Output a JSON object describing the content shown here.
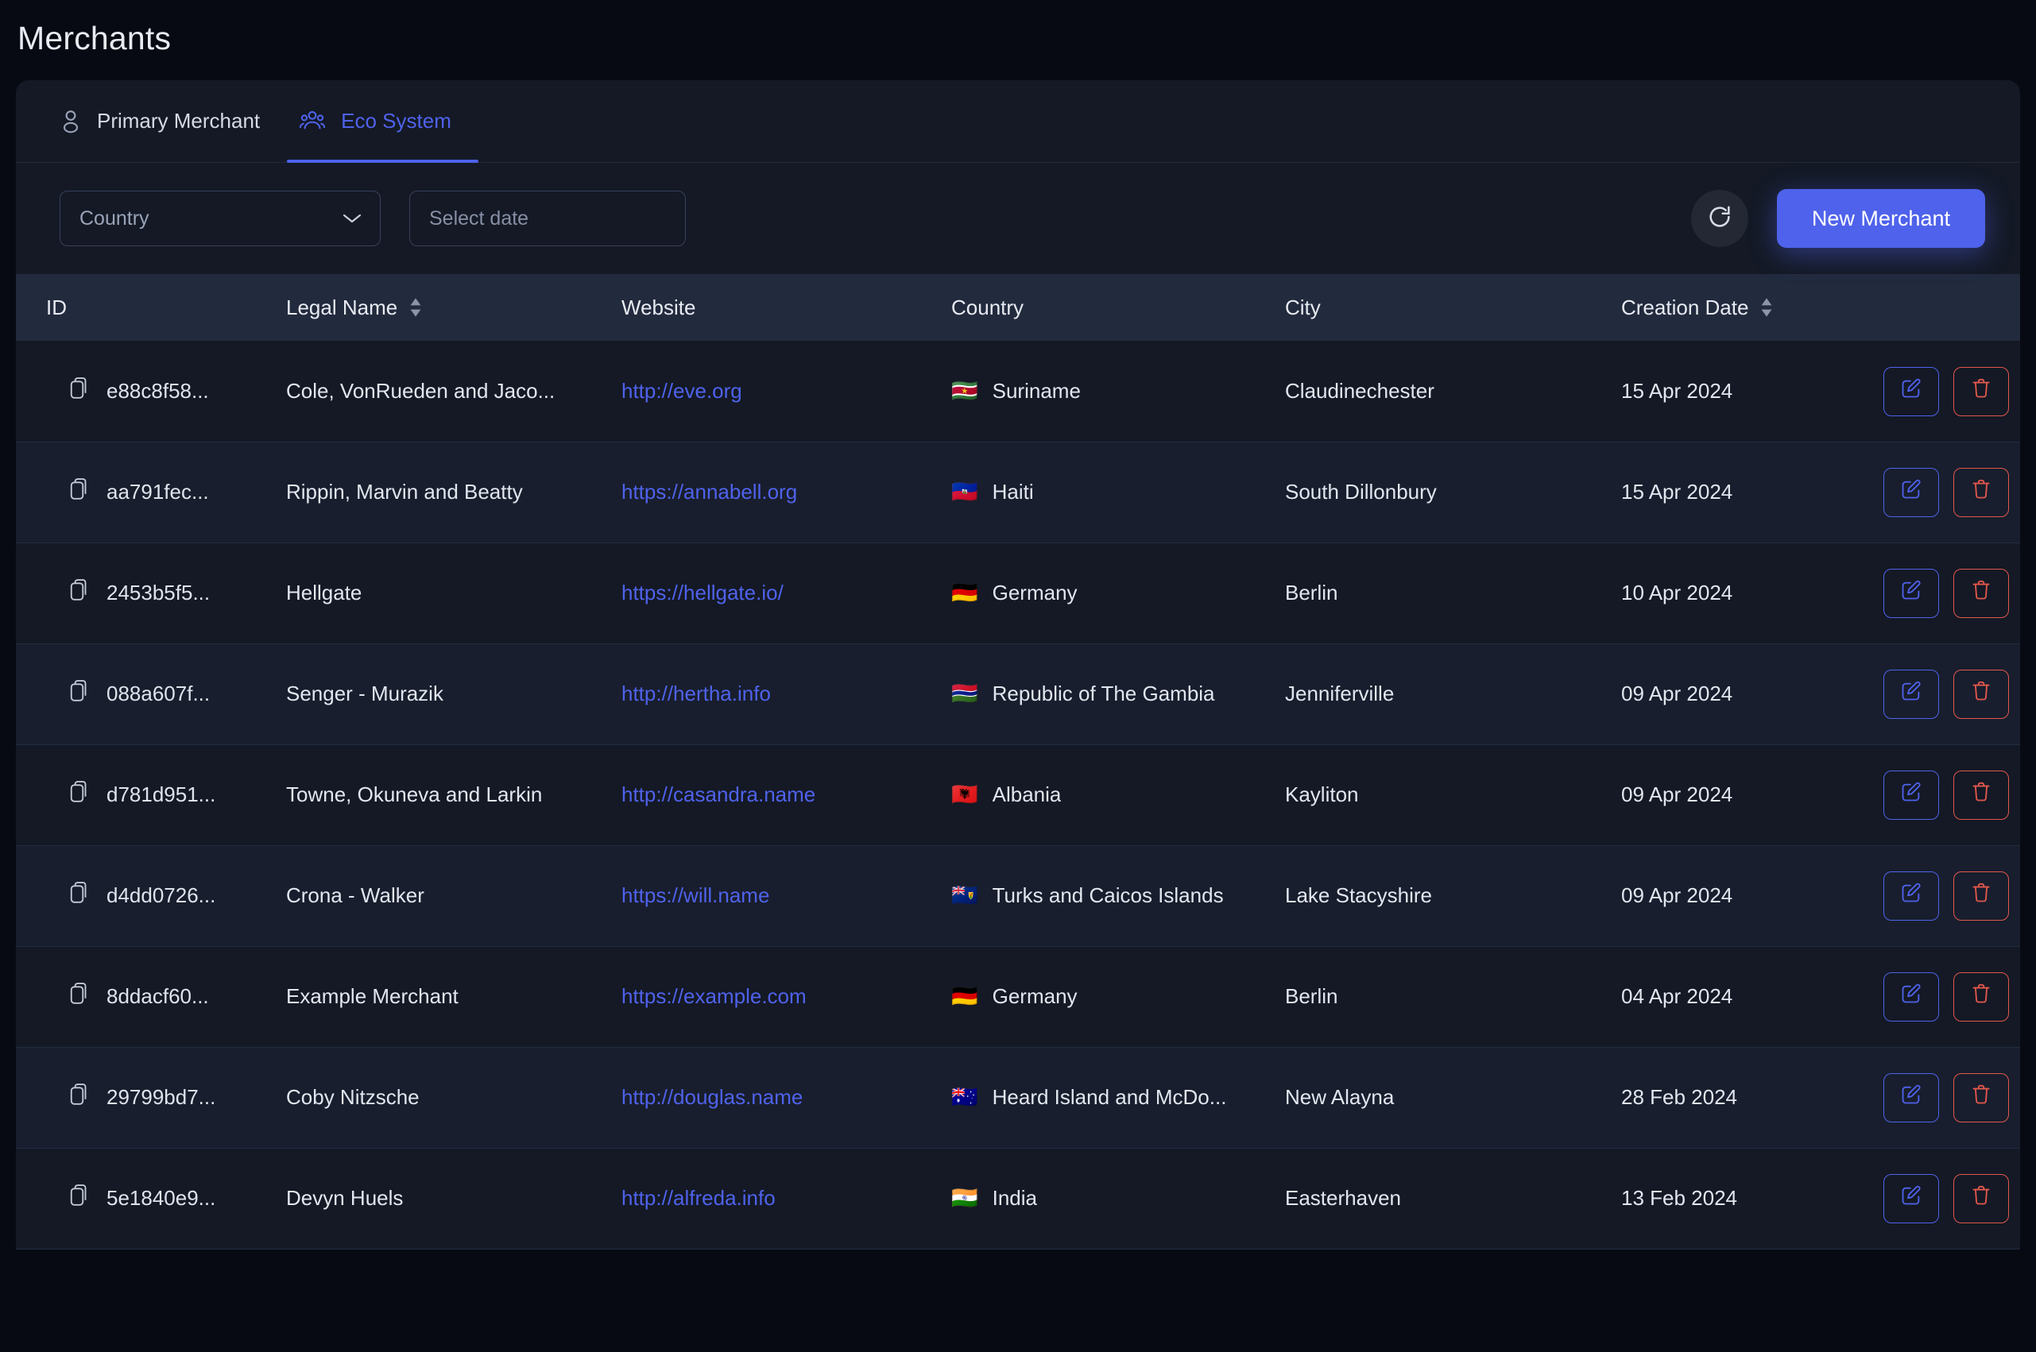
{
  "page": {
    "title": "Merchants"
  },
  "tabs": [
    {
      "label": "Primary Merchant",
      "icon": "user-icon",
      "active": false
    },
    {
      "label": "Eco System",
      "icon": "users-group-icon",
      "active": true
    }
  ],
  "filters": {
    "country_placeholder": "Country",
    "date_placeholder": "Select date",
    "refresh_icon": "refresh-icon"
  },
  "toolbar": {
    "new_merchant_label": "New Merchant",
    "accent_color": "#4f62eb"
  },
  "table": {
    "columns": [
      {
        "key": "id",
        "label": "ID",
        "sortable": false
      },
      {
        "key": "name",
        "label": "Legal Name",
        "sortable": true
      },
      {
        "key": "website",
        "label": "Website",
        "sortable": false
      },
      {
        "key": "country",
        "label": "Country",
        "sortable": false
      },
      {
        "key": "city",
        "label": "City",
        "sortable": false
      },
      {
        "key": "date",
        "label": "Creation Date",
        "sortable": true
      },
      {
        "key": "actions",
        "label": "",
        "sortable": false
      }
    ],
    "rows": [
      {
        "id": "e88c8f58...",
        "name": "Cole, VonRueden and Jaco...",
        "website": "http://eve.org",
        "flag": "🇸🇷",
        "country": "Suriname",
        "city": "Claudinechester",
        "date": "15 Apr 2024"
      },
      {
        "id": "aa791fec...",
        "name": "Rippin, Marvin and Beatty",
        "website": "https://annabell.org",
        "flag": "🇭🇹",
        "country": "Haiti",
        "city": "South Dillonbury",
        "date": "15 Apr 2024"
      },
      {
        "id": "2453b5f5...",
        "name": "Hellgate",
        "website": "https://hellgate.io/",
        "flag": "🇩🇪",
        "country": "Germany",
        "city": "Berlin",
        "date": "10 Apr 2024"
      },
      {
        "id": "088a607f...",
        "name": "Senger - Murazik",
        "website": "http://hertha.info",
        "flag": "🇬🇲",
        "country": "Republic of The Gambia",
        "city": "Jenniferville",
        "date": "09 Apr 2024"
      },
      {
        "id": "d781d951...",
        "name": "Towne, Okuneva and Larkin",
        "website": "http://casandra.name",
        "flag": "🇦🇱",
        "country": "Albania",
        "city": "Kayliton",
        "date": "09 Apr 2024"
      },
      {
        "id": "d4dd0726...",
        "name": "Crona - Walker",
        "website": "https://will.name",
        "flag": "🇹🇨",
        "country": "Turks and Caicos Islands",
        "city": "Lake Stacyshire",
        "date": "09 Apr 2024"
      },
      {
        "id": "8ddacf60...",
        "name": "Example Merchant",
        "website": "https://example.com",
        "flag": "🇩🇪",
        "country": "Germany",
        "city": "Berlin",
        "date": "04 Apr 2024"
      },
      {
        "id": "29799bd7...",
        "name": "Coby Nitzsche",
        "website": "http://douglas.name",
        "flag": "🇭🇲",
        "country": "Heard Island and McDo...",
        "city": "New Alayna",
        "date": "28 Feb 2024"
      },
      {
        "id": "5e1840e9...",
        "name": "Devyn Huels",
        "website": "http://alfreda.info",
        "flag": "🇮🇳",
        "country": "India",
        "city": "Easterhaven",
        "date": "13 Feb 2024"
      }
    ],
    "row_actions": {
      "edit_icon": "edit-pencil-icon",
      "delete_icon": "trash-icon",
      "copy_icon": "copy-icon"
    }
  }
}
